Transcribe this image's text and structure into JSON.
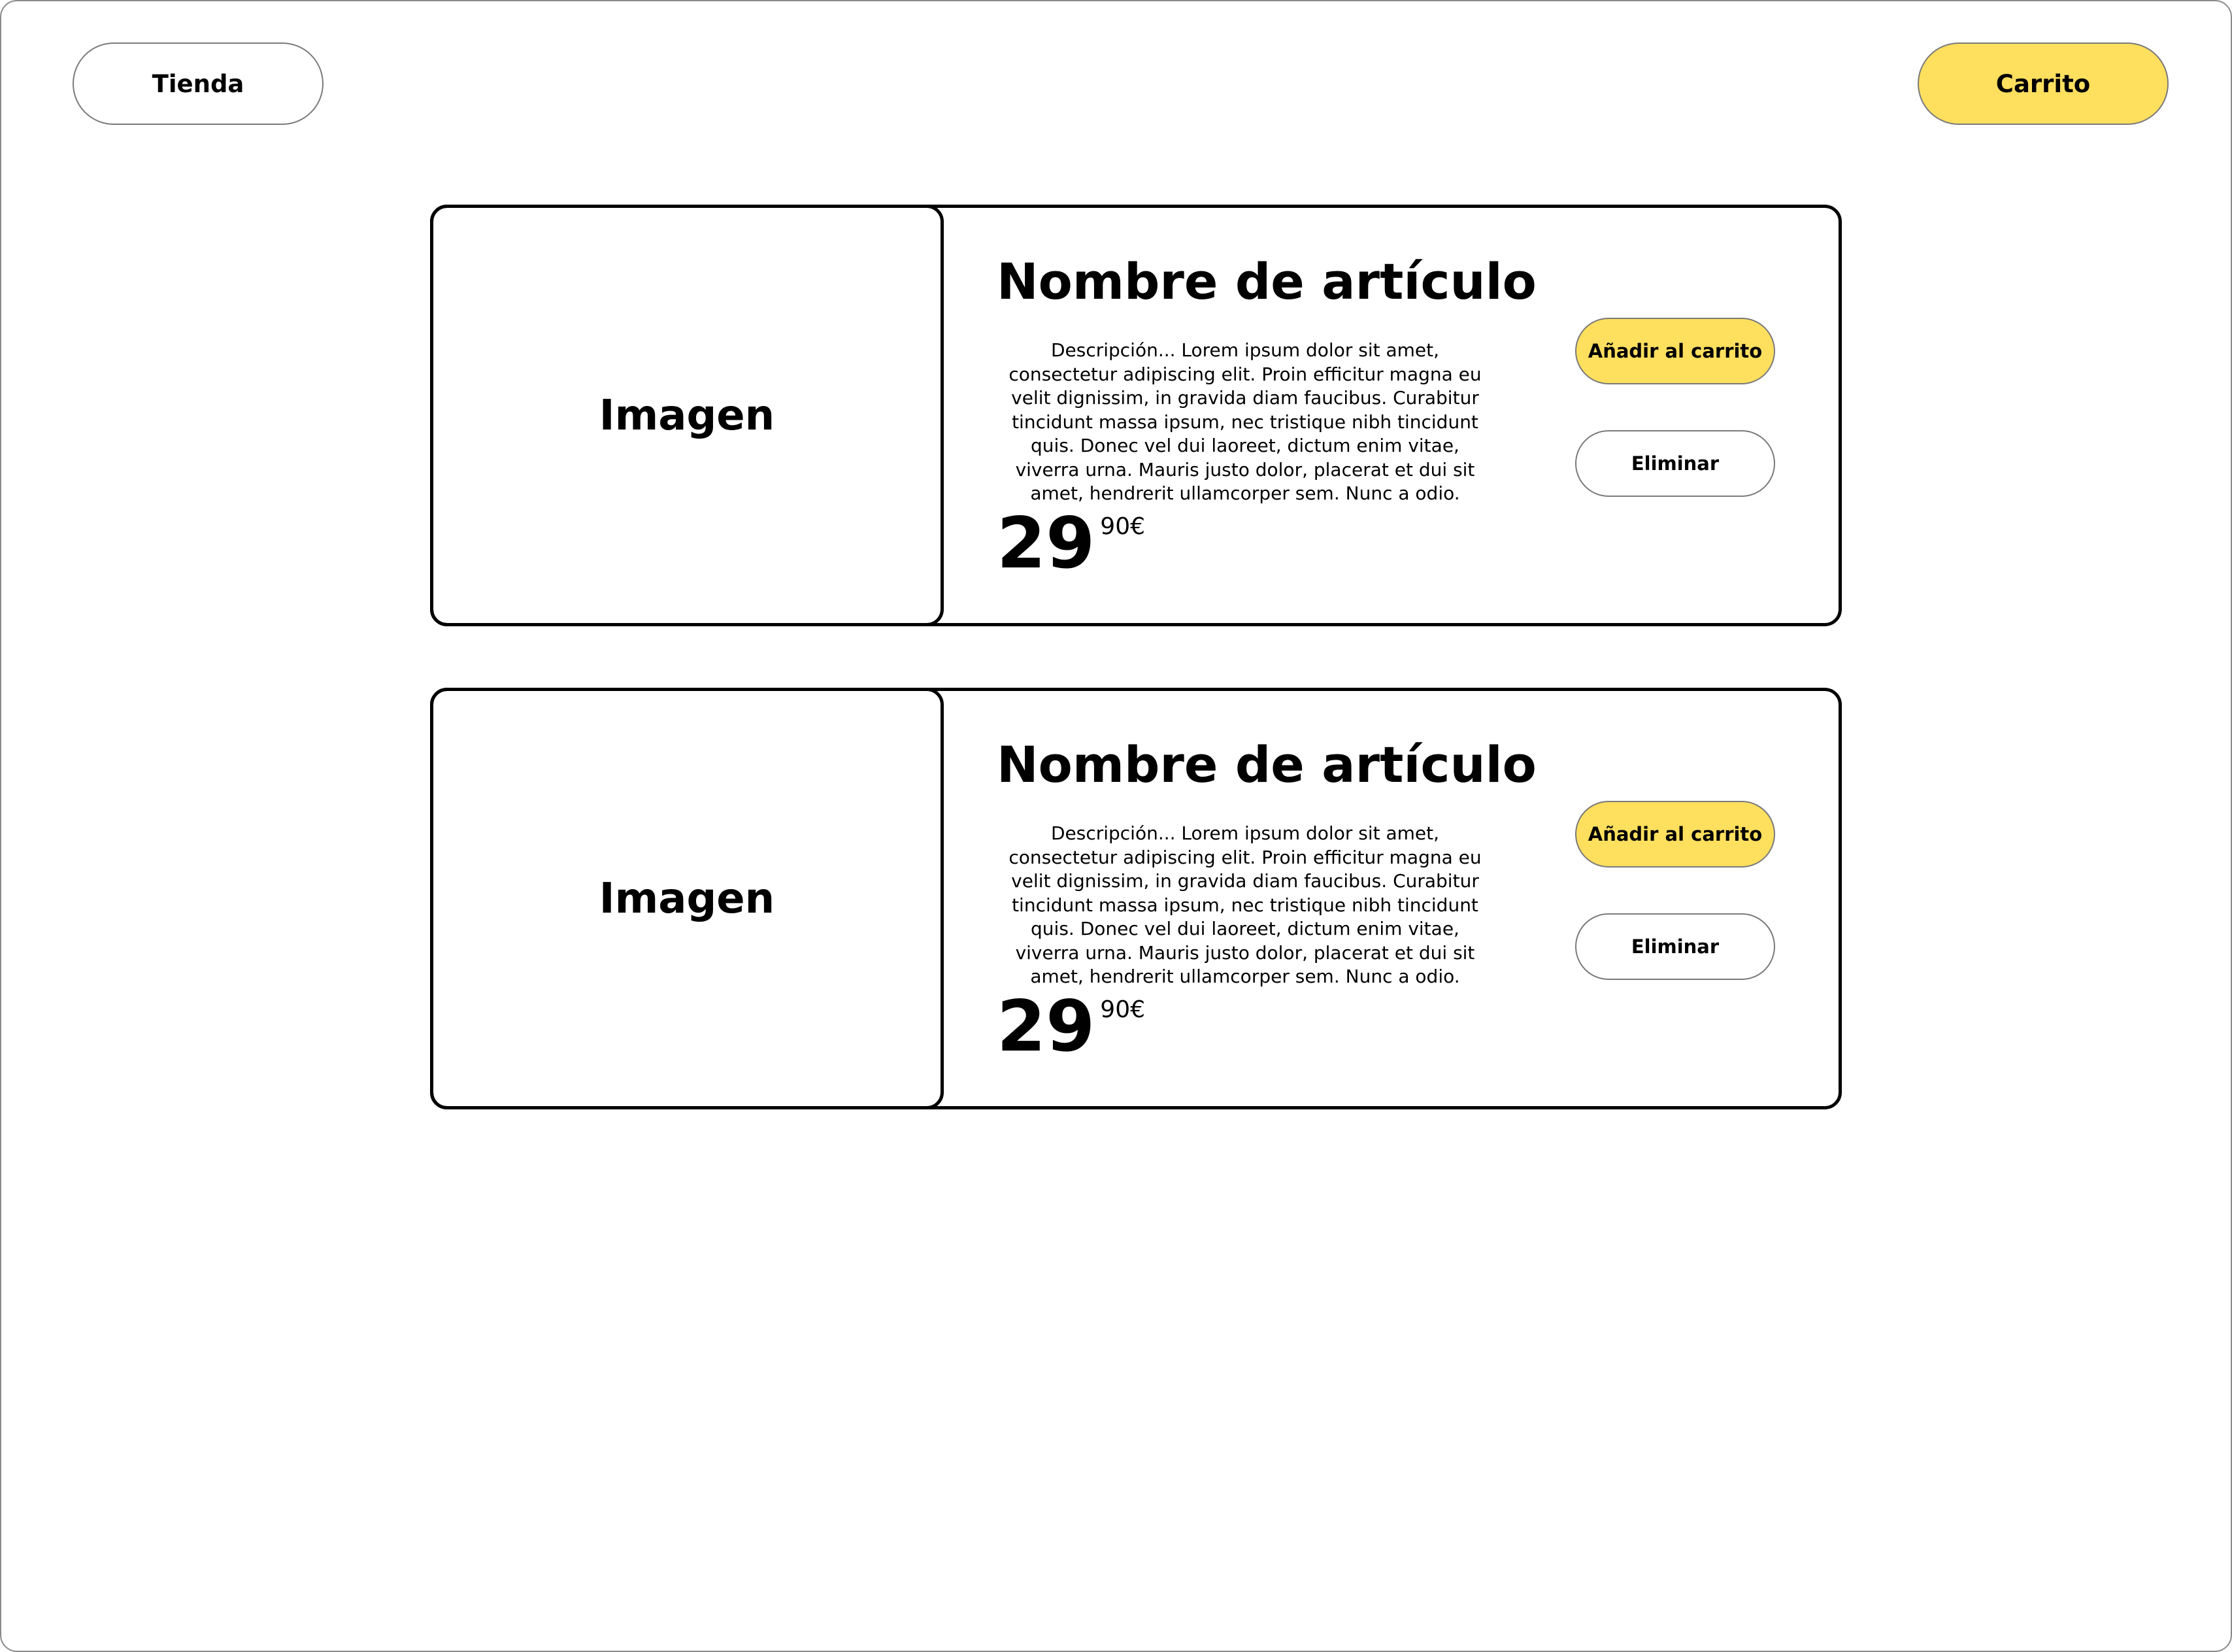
{
  "header": {
    "store_label": "Tienda",
    "cart_label": "Carrito"
  },
  "items": [
    {
      "image_label": "Imagen",
      "title": "Nombre de artículo",
      "description": "Descripción... Lorem ipsum dolor sit amet, consectetur adipiscing elit. Proin efficitur magna eu velit dignissim, in gravida diam faucibus. Curabitur tincidunt massa ipsum, nec tristique nibh tincidunt quis. Donec vel dui laoreet, dictum enim vitae, viverra urna. Mauris justo dolor, placerat et dui sit amet, hendrerit ullamcorper sem. Nunc a odio.",
      "price_integer": "29",
      "price_decimal": "90€",
      "add_label": "Añadir al carrito",
      "remove_label": "Eliminar"
    },
    {
      "image_label": "Imagen",
      "title": "Nombre de artículo",
      "description": "Descripción... Lorem ipsum dolor sit amet, consectetur adipiscing elit. Proin efficitur magna eu velit dignissim, in gravida diam faucibus. Curabitur tincidunt massa ipsum, nec tristique nibh tincidunt quis. Donec vel dui laoreet, dictum enim vitae, viverra urna. Mauris justo dolor, placerat et dui sit amet, hendrerit ullamcorper sem. Nunc a odio.",
      "price_integer": "29",
      "price_decimal": "90€",
      "add_label": "Añadir al carrito",
      "remove_label": "Eliminar"
    }
  ],
  "colors": {
    "accent": "#ffdf5e",
    "border": "#000000",
    "button_border": "#7a7a7a"
  }
}
